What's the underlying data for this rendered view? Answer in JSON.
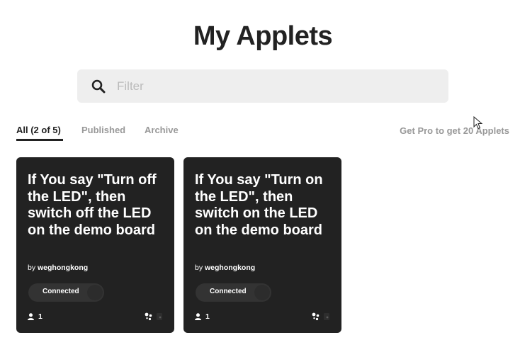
{
  "page": {
    "title": "My Applets"
  },
  "search": {
    "placeholder": "Filter",
    "value": ""
  },
  "tabs": [
    {
      "label": "All (2 of 5)",
      "active": true
    },
    {
      "label": "Published",
      "active": false
    },
    {
      "label": "Archive",
      "active": false
    }
  ],
  "pro_link": "Get Pro to get 20 Applets",
  "applets": [
    {
      "title": "If You say \"Turn off the LED\", then switch off the LED on the demo board",
      "author_prefix": "by",
      "author": "weghongkong",
      "status": "Connected",
      "users": "1",
      "service_icons": [
        "assistant-icon",
        "webhooks-icon"
      ]
    },
    {
      "title": "If You say \"Turn on the LED\", then switch on the LED on the demo board",
      "author_prefix": "by",
      "author": "weghongkong",
      "status": "Connected",
      "users": "1",
      "service_icons": [
        "assistant-icon",
        "webhooks-icon"
      ]
    }
  ],
  "colors": {
    "card_background": "#222222",
    "search_background": "#eeeeee",
    "muted_text": "#999999",
    "text": "#222222"
  }
}
